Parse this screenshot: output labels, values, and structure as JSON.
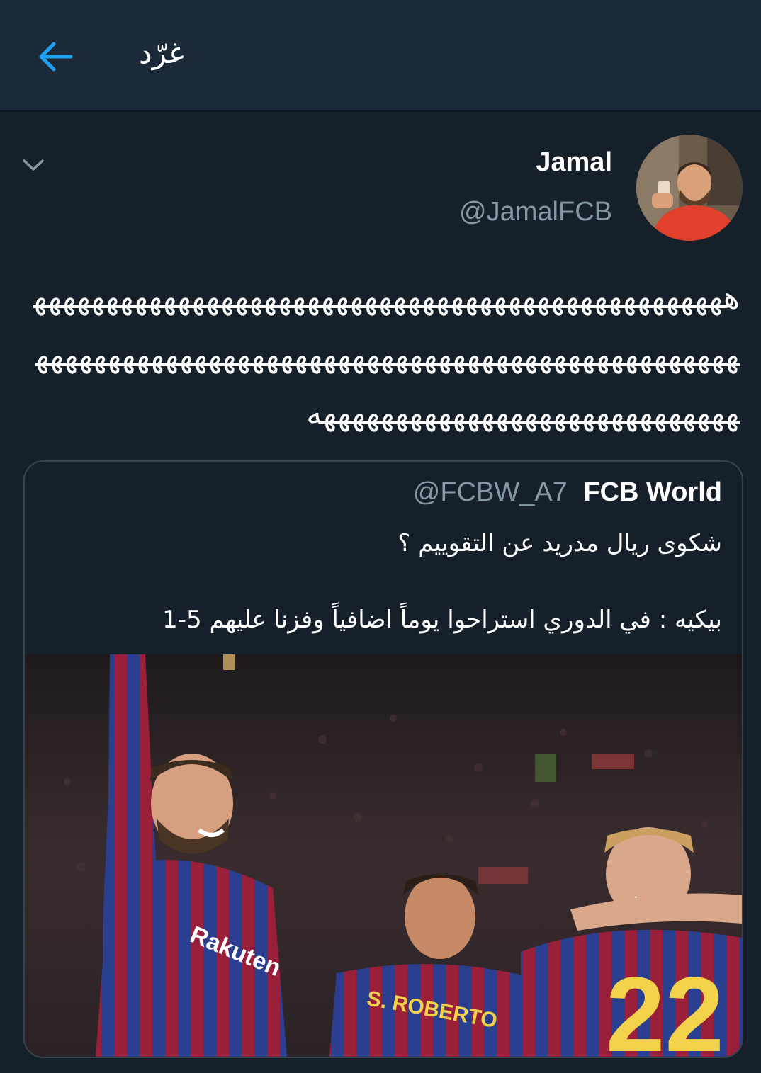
{
  "header": {
    "title": "غرّد",
    "back_icon": "arrow-left-icon"
  },
  "tweet": {
    "display_name": "Jamal",
    "handle": "@JamalFCB",
    "text": "هههههههههههههههههههههههههههههههههههههههههههههههههههههههههههههههههههههههههههههههههههههههههههههههههههههههههههههههههههههههههههههههه",
    "menu_icon": "chevron-down-icon"
  },
  "quoted_tweet": {
    "display_name": "FCB World",
    "handle": "@FCBW_A7",
    "text": "شكوى ريال مدريد عن التقوييم ؟\n\nبيكيه : في الدوري استراحوا يوماً اضافياً وفزنا عليهم 5-1",
    "media": {
      "jersey_name": "S. ROBERTO",
      "jersey_number": "22",
      "sponsor": "Rakuten"
    }
  },
  "colors": {
    "background": "#15202b",
    "header": "#1c2938",
    "accent": "#1da1f2",
    "secondary_text": "#8899a6",
    "border": "#38444d"
  }
}
